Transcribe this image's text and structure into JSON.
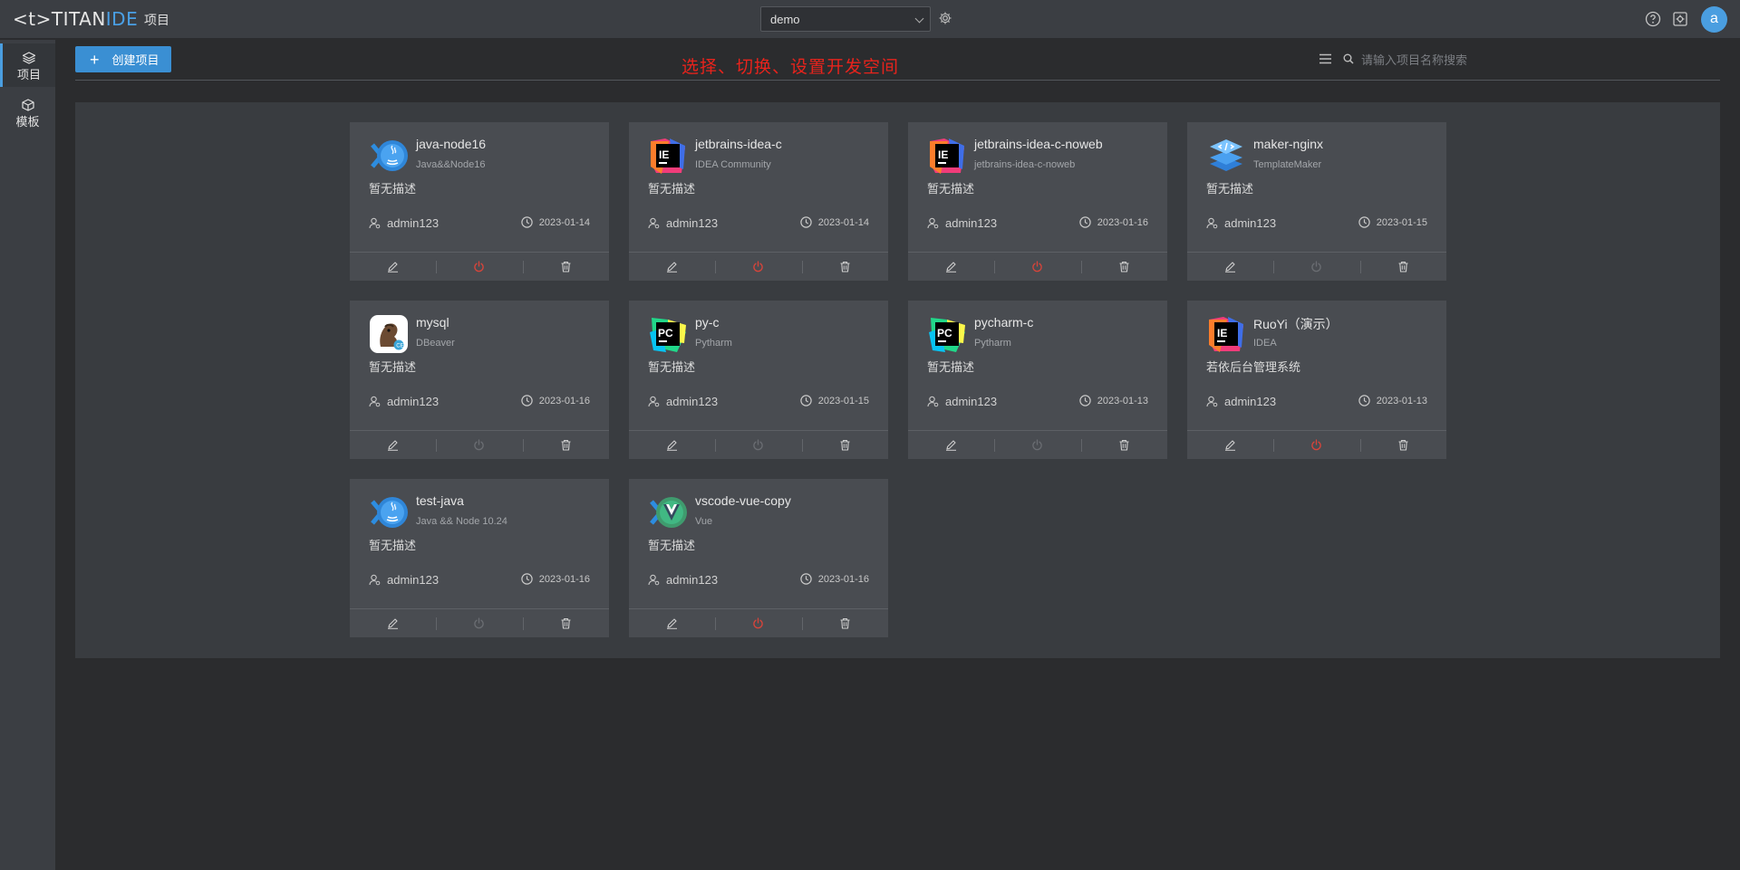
{
  "app": {
    "logo_left": "<t>",
    "logo_brand": "TITAN",
    "logo_ide": "IDE",
    "nav_label": "项目"
  },
  "workspace": {
    "selected": "demo"
  },
  "user": {
    "avatar_letter": "a"
  },
  "sidebar": {
    "items": [
      {
        "label": "项目",
        "icon": "layers-icon",
        "active": true
      },
      {
        "label": "模板",
        "icon": "cube-icon",
        "active": false
      }
    ]
  },
  "toolbar": {
    "create_label": "创建项目",
    "banner": "选择、切换、设置开发空间",
    "search_placeholder": "请输入项目名称搜索"
  },
  "colors": {
    "accent": "#3a8fd3",
    "banner_red": "#e8231c",
    "power_active": "#d9443a",
    "power_inactive": "#6a6d72"
  },
  "projects": [
    {
      "name": "java-node16",
      "template": "Java&&Node16",
      "desc": "暂无描述",
      "owner": "admin123",
      "date": "2023-01-14",
      "logo": "java-node-logo",
      "running": true
    },
    {
      "name": "jetbrains-idea-c",
      "template": "IDEA Community",
      "desc": "暂无描述",
      "owner": "admin123",
      "date": "2023-01-14",
      "logo": "intellij-logo",
      "running": true
    },
    {
      "name": "jetbrains-idea-c-noweb",
      "template": "jetbrains-idea-c-noweb",
      "desc": "暂无描述",
      "owner": "admin123",
      "date": "2023-01-16",
      "logo": "intellij-logo",
      "running": true
    },
    {
      "name": "maker-nginx",
      "template": "TemplateMaker",
      "desc": "暂无描述",
      "owner": "admin123",
      "date": "2023-01-15",
      "logo": "template-maker-logo",
      "running": false
    },
    {
      "name": "mysql",
      "template": "DBeaver",
      "desc": "暂无描述",
      "owner": "admin123",
      "date": "2023-01-16",
      "logo": "dbeaver-logo",
      "running": false
    },
    {
      "name": "py-c",
      "template": "Pytharm",
      "desc": "暂无描述",
      "owner": "admin123",
      "date": "2023-01-15",
      "logo": "pycharm-logo",
      "running": false
    },
    {
      "name": "pycharm-c",
      "template": "Pytharm",
      "desc": "暂无描述",
      "owner": "admin123",
      "date": "2023-01-13",
      "logo": "pycharm-logo",
      "running": false
    },
    {
      "name": "RuoYi（演示）",
      "template": "IDEA",
      "desc": "若依后台管理系统",
      "owner": "admin123",
      "date": "2023-01-13",
      "logo": "intellij-logo",
      "running": true
    },
    {
      "name": "test-java",
      "template": "Java && Node 10.24",
      "desc": "暂无描述",
      "owner": "admin123",
      "date": "2023-01-16",
      "logo": "java-node-logo",
      "running": false
    },
    {
      "name": "vscode-vue-copy",
      "template": "Vue",
      "desc": "暂无描述",
      "owner": "admin123",
      "date": "2023-01-16",
      "logo": "vscode-vue-logo",
      "running": true
    }
  ]
}
